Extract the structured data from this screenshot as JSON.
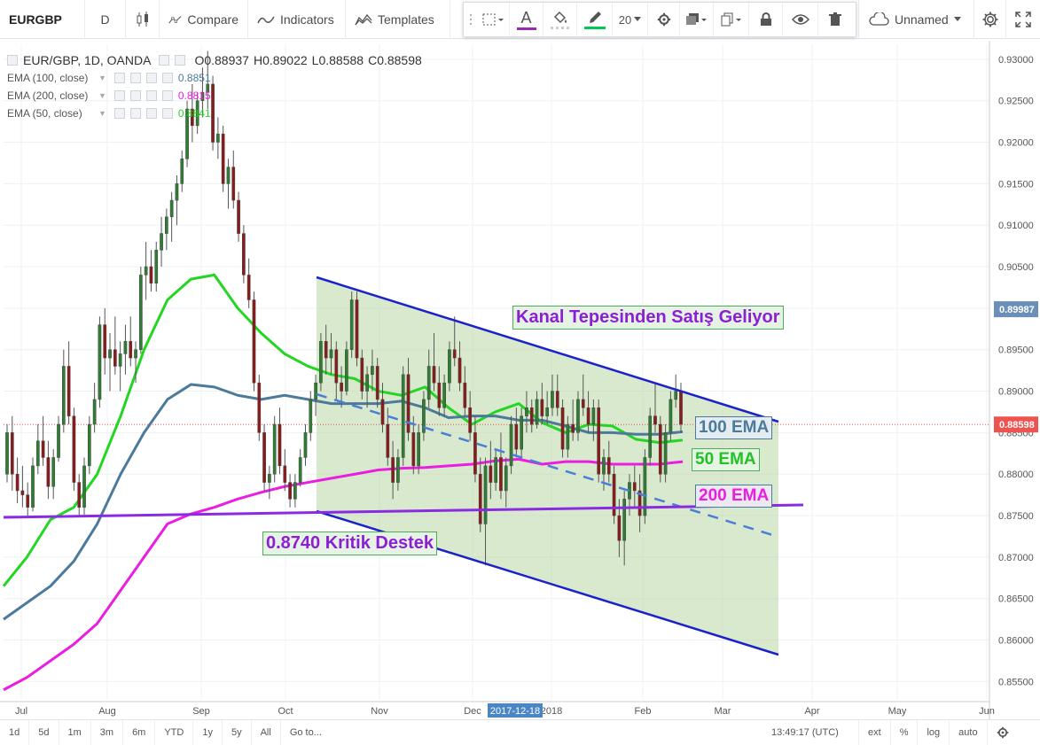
{
  "toolbar": {
    "symbol": "EURGBP",
    "interval": "D",
    "compare": "Compare",
    "indicators": "Indicators",
    "templates": "Templates",
    "line_width": "20",
    "layout_name": "Unnamed",
    "colors": {
      "text_tool": "#9c27b0",
      "line_tool": "#00c853"
    }
  },
  "legend": {
    "main": "EUR/GBP, 1D, OANDA",
    "ohlc": {
      "o": "O0.88937",
      "h": "H0.89022",
      "l": "L0.88588",
      "c": "C0.88598"
    },
    "indicators": [
      {
        "label": "EMA (100, close)",
        "value": "0.8851",
        "color": "#4c7a9a"
      },
      {
        "label": "EMA (200, close)",
        "value": "0.8815",
        "color": "#e91ee0"
      },
      {
        "label": "EMA (50, close)",
        "value": "0.8841",
        "color": "#22d622"
      }
    ]
  },
  "annotations": {
    "channel_top": "Kanal Tepesinden Satış Geliyor",
    "ema100": "100 EMA",
    "ema50": "50 EMA",
    "ema200": "200 EMA",
    "support": "0.8740 Kritik Destek"
  },
  "bottombar": {
    "ranges": [
      "1d",
      "5d",
      "1m",
      "3m",
      "6m",
      "YTD",
      "1y",
      "5y",
      "All"
    ],
    "goto": "Go to...",
    "time": "13:49:17 (UTC)",
    "options": [
      "ext",
      "%",
      "log",
      "auto"
    ]
  },
  "chart_data": {
    "type": "candlestick",
    "symbol": "EUR/GBP",
    "ylim": [
      0.8528,
      0.9318
    ],
    "y_ticks": [
      "0.93000",
      "0.92500",
      "0.92000",
      "0.91500",
      "0.91000",
      "0.90500",
      "0.90000",
      "0.89500",
      "0.89000",
      "0.88500",
      "0.88000",
      "0.87500",
      "0.87000",
      "0.86500",
      "0.86000",
      "0.85500"
    ],
    "x_ticks": [
      "Jul",
      "Aug",
      "Sep",
      "Oct",
      "Nov",
      "Dec",
      "2018",
      "Feb",
      "Mar",
      "Apr",
      "May",
      "Jun"
    ],
    "x_crosshair_label": "2017-12-18",
    "price_labels": [
      {
        "value": 0.89987,
        "text": "0.89987",
        "color": "#6b8fb8"
      },
      {
        "value": 0.88598,
        "text": "0.88598",
        "color": "#ef5350"
      }
    ],
    "candle_colors": {
      "up": "#2e7d32",
      "down": "#8b1a1a"
    },
    "candles": [
      [
        0.88,
        0.886,
        0.879,
        0.885
      ],
      [
        0.885,
        0.887,
        0.878,
        0.88
      ],
      [
        0.88,
        0.882,
        0.8765,
        0.878
      ],
      [
        0.878,
        0.881,
        0.876,
        0.8775
      ],
      [
        0.8775,
        0.879,
        0.875,
        0.876
      ],
      [
        0.876,
        0.882,
        0.8755,
        0.881
      ],
      [
        0.881,
        0.886,
        0.88,
        0.884
      ],
      [
        0.884,
        0.887,
        0.881,
        0.882
      ],
      [
        0.882,
        0.884,
        0.877,
        0.8785
      ],
      [
        0.8785,
        0.883,
        0.877,
        0.882
      ],
      [
        0.882,
        0.887,
        0.8815,
        0.886
      ],
      [
        0.886,
        0.895,
        0.885,
        0.893
      ],
      [
        0.893,
        0.896,
        0.886,
        0.887
      ],
      [
        0.887,
        0.888,
        0.878,
        0.879
      ],
      [
        0.879,
        0.88,
        0.875,
        0.876
      ],
      [
        0.876,
        0.882,
        0.875,
        0.881
      ],
      [
        0.881,
        0.887,
        0.88,
        0.886
      ],
      [
        0.886,
        0.891,
        0.885,
        0.889
      ],
      [
        0.889,
        0.899,
        0.888,
        0.898
      ],
      [
        0.898,
        0.9,
        0.892,
        0.894
      ],
      [
        0.894,
        0.897,
        0.89,
        0.895
      ],
      [
        0.895,
        0.899,
        0.892,
        0.893
      ],
      [
        0.893,
        0.896,
        0.89,
        0.8945
      ],
      [
        0.8945,
        0.898,
        0.892,
        0.896
      ],
      [
        0.896,
        0.899,
        0.893,
        0.894
      ],
      [
        0.894,
        0.896,
        0.891,
        0.895
      ],
      [
        0.895,
        0.905,
        0.8945,
        0.904
      ],
      [
        0.904,
        0.908,
        0.901,
        0.905
      ],
      [
        0.905,
        0.907,
        0.902,
        0.903
      ],
      [
        0.903,
        0.908,
        0.902,
        0.907
      ],
      [
        0.907,
        0.911,
        0.905,
        0.909
      ],
      [
        0.909,
        0.912,
        0.907,
        0.911
      ],
      [
        0.911,
        0.914,
        0.908,
        0.913
      ],
      [
        0.913,
        0.916,
        0.91,
        0.915
      ],
      [
        0.915,
        0.919,
        0.914,
        0.918
      ],
      [
        0.918,
        0.925,
        0.917,
        0.924
      ],
      [
        0.924,
        0.927,
        0.92,
        0.922
      ],
      [
        0.922,
        0.926,
        0.921,
        0.925
      ],
      [
        0.925,
        0.929,
        0.923,
        0.926
      ],
      [
        0.926,
        0.931,
        0.924,
        0.927
      ],
      [
        0.927,
        0.928,
        0.919,
        0.92
      ],
      [
        0.92,
        0.923,
        0.918,
        0.921
      ],
      [
        0.921,
        0.922,
        0.914,
        0.915
      ],
      [
        0.915,
        0.918,
        0.912,
        0.917
      ],
      [
        0.917,
        0.919,
        0.912,
        0.913
      ],
      [
        0.913,
        0.914,
        0.908,
        0.909
      ],
      [
        0.909,
        0.91,
        0.903,
        0.904
      ],
      [
        0.904,
        0.906,
        0.9,
        0.901
      ],
      [
        0.901,
        0.902,
        0.89,
        0.891
      ],
      [
        0.891,
        0.892,
        0.884,
        0.885
      ],
      [
        0.885,
        0.886,
        0.878,
        0.879
      ],
      [
        0.879,
        0.881,
        0.877,
        0.88
      ],
      [
        0.88,
        0.887,
        0.879,
        0.886
      ],
      [
        0.886,
        0.888,
        0.88,
        0.881
      ],
      [
        0.881,
        0.883,
        0.878,
        0.879
      ],
      [
        0.879,
        0.88,
        0.876,
        0.877
      ],
      [
        0.877,
        0.88,
        0.876,
        0.879
      ],
      [
        0.879,
        0.883,
        0.8785,
        0.882
      ],
      [
        0.882,
        0.886,
        0.881,
        0.885
      ],
      [
        0.885,
        0.89,
        0.884,
        0.889
      ],
      [
        0.889,
        0.892,
        0.887,
        0.891
      ],
      [
        0.891,
        0.897,
        0.89,
        0.896
      ],
      [
        0.896,
        0.898,
        0.892,
        0.894
      ],
      [
        0.894,
        0.897,
        0.892,
        0.895
      ],
      [
        0.895,
        0.896,
        0.889,
        0.891
      ],
      [
        0.891,
        0.893,
        0.888,
        0.89
      ],
      [
        0.89,
        0.896,
        0.8895,
        0.895
      ],
      [
        0.895,
        0.902,
        0.894,
        0.901
      ],
      [
        0.901,
        0.902,
        0.893,
        0.894
      ],
      [
        0.894,
        0.895,
        0.889,
        0.89
      ],
      [
        0.89,
        0.893,
        0.888,
        0.892
      ],
      [
        0.892,
        0.895,
        0.89,
        0.893
      ],
      [
        0.893,
        0.894,
        0.888,
        0.889
      ],
      [
        0.889,
        0.891,
        0.885,
        0.886
      ],
      [
        0.886,
        0.888,
        0.881,
        0.882
      ],
      [
        0.882,
        0.884,
        0.877,
        0.879
      ],
      [
        0.879,
        0.883,
        0.878,
        0.882
      ],
      [
        0.882,
        0.893,
        0.881,
        0.892
      ],
      [
        0.892,
        0.894,
        0.884,
        0.885
      ],
      [
        0.885,
        0.887,
        0.88,
        0.881
      ],
      [
        0.881,
        0.886,
        0.88,
        0.885
      ],
      [
        0.885,
        0.89,
        0.884,
        0.889
      ],
      [
        0.889,
        0.895,
        0.888,
        0.893
      ],
      [
        0.893,
        0.897,
        0.89,
        0.891
      ],
      [
        0.891,
        0.893,
        0.887,
        0.888
      ],
      [
        0.888,
        0.892,
        0.887,
        0.891
      ],
      [
        0.891,
        0.896,
        0.89,
        0.895
      ],
      [
        0.895,
        0.899,
        0.893,
        0.894
      ],
      [
        0.894,
        0.896,
        0.89,
        0.891
      ],
      [
        0.891,
        0.893,
        0.887,
        0.888
      ],
      [
        0.888,
        0.89,
        0.884,
        0.885
      ],
      [
        0.885,
        0.887,
        0.879,
        0.88
      ],
      [
        0.88,
        0.882,
        0.873,
        0.874
      ],
      [
        0.874,
        0.882,
        0.869,
        0.881
      ],
      [
        0.881,
        0.884,
        0.877,
        0.879
      ],
      [
        0.879,
        0.883,
        0.878,
        0.882
      ],
      [
        0.882,
        0.885,
        0.877,
        0.878
      ],
      [
        0.878,
        0.882,
        0.876,
        0.881
      ],
      [
        0.881,
        0.887,
        0.88,
        0.886
      ],
      [
        0.886,
        0.888,
        0.882,
        0.883
      ],
      [
        0.883,
        0.888,
        0.882,
        0.887
      ],
      [
        0.887,
        0.89,
        0.885,
        0.888
      ],
      [
        0.888,
        0.889,
        0.885,
        0.886
      ],
      [
        0.886,
        0.89,
        0.8855,
        0.889
      ],
      [
        0.889,
        0.891,
        0.886,
        0.887
      ],
      [
        0.887,
        0.89,
        0.886,
        0.888
      ],
      [
        0.888,
        0.892,
        0.887,
        0.89
      ],
      [
        0.89,
        0.892,
        0.887,
        0.888
      ],
      [
        0.888,
        0.889,
        0.882,
        0.883
      ],
      [
        0.883,
        0.887,
        0.882,
        0.886
      ],
      [
        0.886,
        0.889,
        0.884,
        0.885
      ],
      [
        0.885,
        0.89,
        0.884,
        0.889
      ],
      [
        0.889,
        0.892,
        0.887,
        0.888
      ],
      [
        0.888,
        0.89,
        0.885,
        0.886
      ],
      [
        0.886,
        0.889,
        0.884,
        0.888
      ],
      [
        0.888,
        0.889,
        0.879,
        0.88
      ],
      [
        0.88,
        0.883,
        0.878,
        0.882
      ],
      [
        0.882,
        0.884,
        0.879,
        0.88
      ],
      [
        0.88,
        0.881,
        0.874,
        0.875
      ],
      [
        0.875,
        0.877,
        0.87,
        0.872
      ],
      [
        0.872,
        0.878,
        0.869,
        0.877
      ],
      [
        0.877,
        0.88,
        0.875,
        0.879
      ],
      [
        0.879,
        0.881,
        0.876,
        0.878
      ],
      [
        0.878,
        0.88,
        0.873,
        0.875
      ],
      [
        0.875,
        0.883,
        0.874,
        0.882
      ],
      [
        0.882,
        0.888,
        0.881,
        0.887
      ],
      [
        0.887,
        0.891,
        0.885,
        0.886
      ],
      [
        0.886,
        0.887,
        0.879,
        0.88
      ],
      [
        0.88,
        0.886,
        0.879,
        0.885
      ],
      [
        0.885,
        0.89,
        0.884,
        0.889
      ],
      [
        0.889,
        0.892,
        0.888,
        0.89
      ],
      [
        0.89,
        0.891,
        0.885,
        0.886
      ]
    ],
    "ema_series": [
      {
        "period": 50,
        "color": "#22d622",
        "values": [
          0.8665,
          0.87,
          0.8745,
          0.876,
          0.88,
          0.887,
          0.895,
          0.901,
          0.9035,
          0.904,
          0.9,
          0.897,
          0.8945,
          0.893,
          0.892,
          0.8915,
          0.89,
          0.8895,
          0.8905,
          0.888,
          0.886,
          0.8875,
          0.8885,
          0.8862,
          0.885,
          0.886,
          0.8858,
          0.8842,
          0.8838,
          0.8841
        ]
      },
      {
        "period": 100,
        "color": "#4c7a9a",
        "values": [
          0.8625,
          0.8645,
          0.8665,
          0.8695,
          0.874,
          0.88,
          0.885,
          0.889,
          0.8908,
          0.8905,
          0.8895,
          0.889,
          0.8895,
          0.889,
          0.8885,
          0.8885,
          0.8885,
          0.8888,
          0.888,
          0.8868,
          0.887,
          0.887,
          0.8865,
          0.8865,
          0.8858,
          0.885,
          0.885,
          0.8848,
          0.8848,
          0.8851
        ]
      },
      {
        "period": 200,
        "color": "#e91ee0",
        "values": [
          0.854,
          0.8555,
          0.8575,
          0.8595,
          0.862,
          0.866,
          0.87,
          0.874,
          0.8752,
          0.876,
          0.877,
          0.8778,
          0.8785,
          0.879,
          0.8795,
          0.88,
          0.8805,
          0.8807,
          0.8808,
          0.881,
          0.8812,
          0.8816,
          0.8818,
          0.8812,
          0.8815,
          0.8815,
          0.8812,
          0.8812,
          0.8812,
          0.8815
        ]
      }
    ]
  }
}
